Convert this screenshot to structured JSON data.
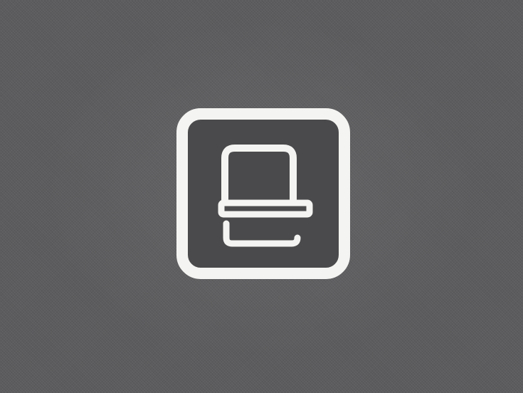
{
  "screen": {
    "background_color": "#5c5c5e"
  },
  "icon": {
    "name": "app-icon",
    "glyph": "device-in-rounded-square",
    "stroke_color": "#f4f4f2",
    "fill_color": "#4a4a4c"
  }
}
